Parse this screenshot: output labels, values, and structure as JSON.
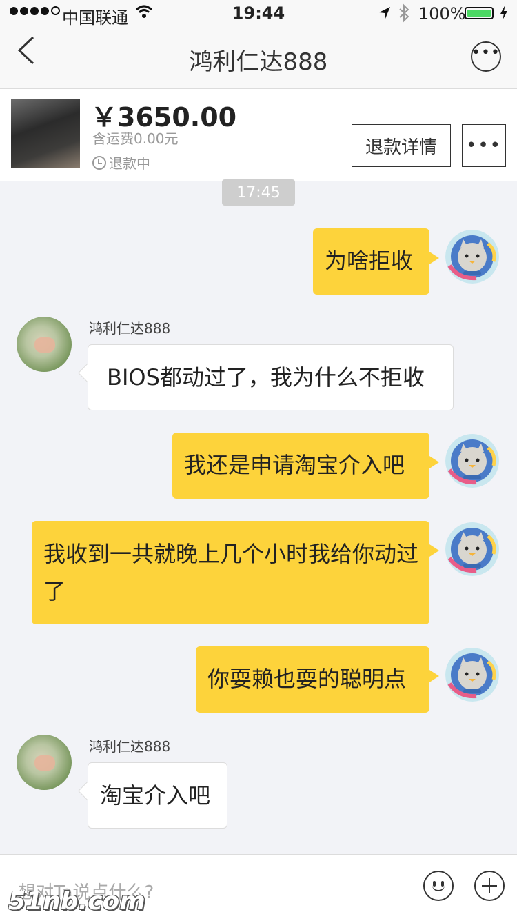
{
  "status_bar": {
    "carrier": "中国联通",
    "time": "19:44",
    "battery_pct": "100%",
    "battery_level": 1.0
  },
  "nav": {
    "title": "鸿利仁达888"
  },
  "order": {
    "price": "￥3650.00",
    "shipping": "含运费0.00元",
    "status": "退款中",
    "refund_button": "退款详情",
    "more_button": "•••"
  },
  "chat": {
    "timestamp": "17:45",
    "messages": [
      {
        "from": "me",
        "text": "为啥拒收"
      },
      {
        "from": "other",
        "sender": "鸿利仁达888",
        "text": "BIOS都动过了，我为什么不拒收"
      },
      {
        "from": "me",
        "text": "我还是申请淘宝介入吧"
      },
      {
        "from": "me",
        "text": "我收到一共就晚上几个小时我给你动过了"
      },
      {
        "from": "me",
        "text": "你耍赖也耍的聪明点"
      },
      {
        "from": "other",
        "sender": "鸿利仁达888",
        "text": "淘宝介入吧"
      }
    ]
  },
  "input": {
    "placeholder": "想对Ta说点什么?"
  },
  "watermark": "51nb.com",
  "colors": {
    "my_bubble": "#fdd33b",
    "background": "#f2f3f7",
    "battery": "#4cd964"
  }
}
